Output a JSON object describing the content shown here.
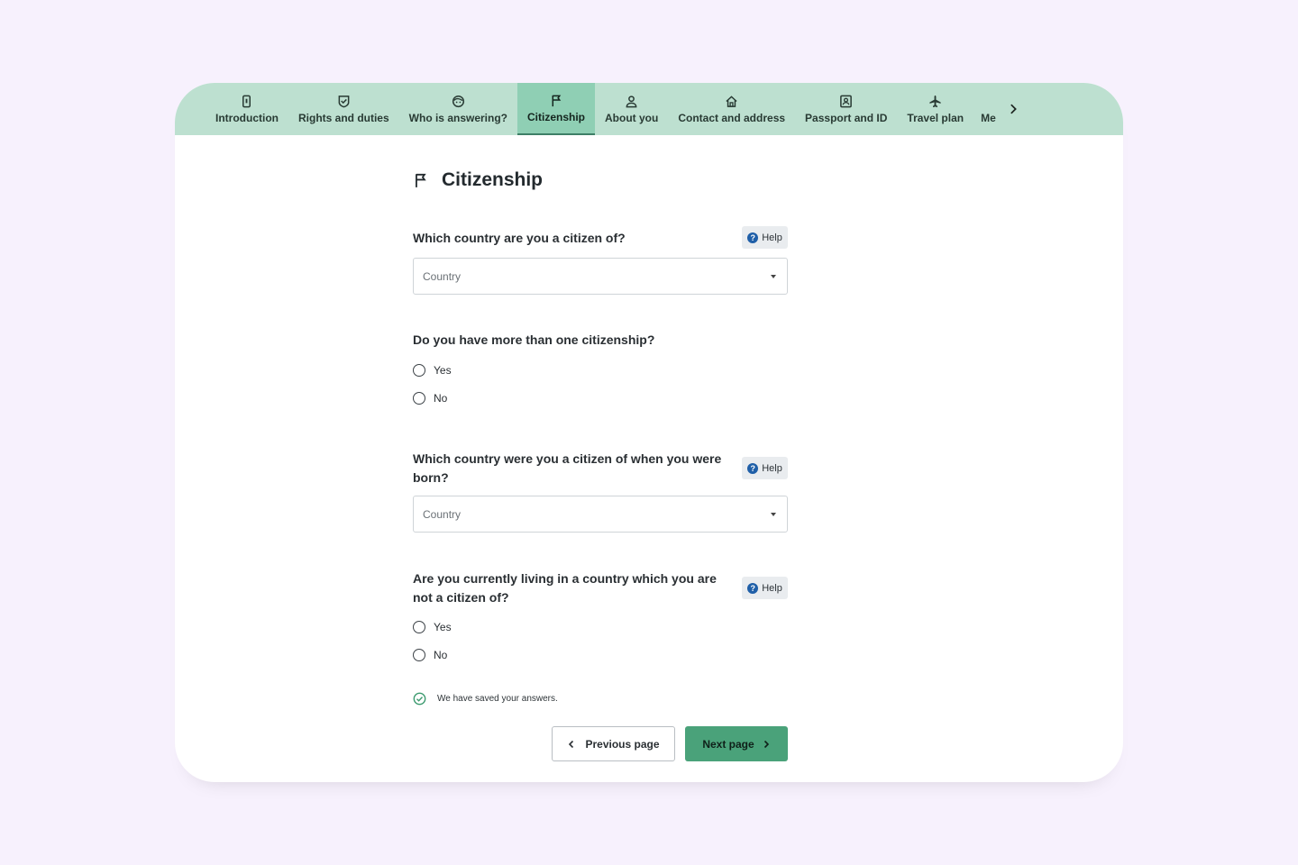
{
  "tabs": [
    {
      "label": "Introduction",
      "icon": "phone-icon",
      "active": false
    },
    {
      "label": "Rights and duties",
      "icon": "shield-check-icon",
      "active": false
    },
    {
      "label": "Who is answering?",
      "icon": "face-icon",
      "active": false
    },
    {
      "label": "Citizenship",
      "icon": "flag-icon",
      "active": true
    },
    {
      "label": "About you",
      "icon": "person-icon",
      "active": false
    },
    {
      "label": "Contact and address",
      "icon": "home-icon",
      "active": false
    },
    {
      "label": "Passport and ID",
      "icon": "id-card-icon",
      "active": false
    },
    {
      "label": "Travel plan",
      "icon": "airplane-icon",
      "active": false
    },
    {
      "label": "Me",
      "icon": "",
      "active": false
    }
  ],
  "page": {
    "title": "Citizenship",
    "title_icon": "flag-icon"
  },
  "q1": {
    "question": "Which country are you a citizen of?",
    "help": "Help",
    "select_placeholder": "Country"
  },
  "q2": {
    "question": "Do you have more than one citizenship?",
    "options": [
      "Yes",
      "No"
    ]
  },
  "q3": {
    "question": "Which country were you a citizen of when you were born?",
    "help": "Help",
    "select_placeholder": "Country"
  },
  "q4": {
    "question": "Are you currently living in a country which you are not a citizen of?",
    "help": "Help",
    "options": [
      "Yes",
      "No"
    ]
  },
  "status": {
    "saved_text": "We have saved your answers."
  },
  "nav": {
    "prev_label": "Previous page",
    "next_label": "Next page"
  },
  "colors": {
    "page_bg": "#f7f1fd",
    "tabbar_bg": "#bde0d0",
    "tab_active_bg": "#8fcfb4",
    "next_button": "#4aa27a",
    "help_icon": "#1f5fa8"
  }
}
